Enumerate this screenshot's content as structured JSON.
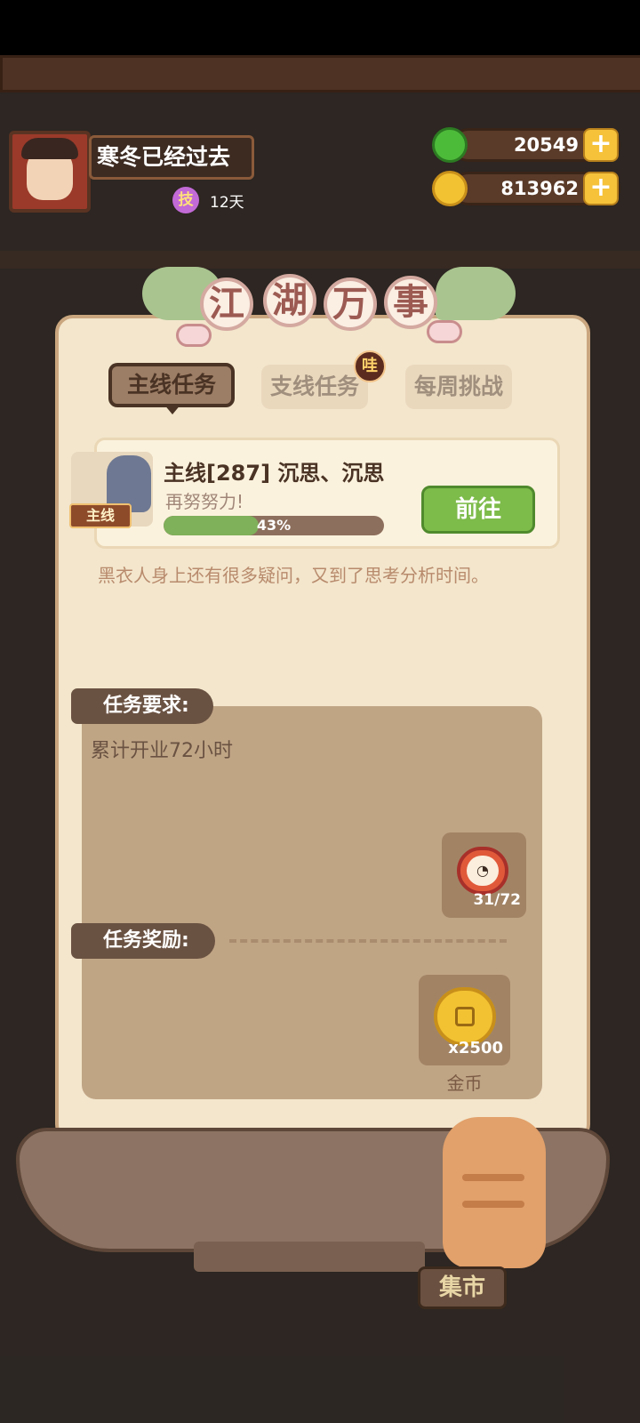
{
  "header": {
    "player_name": "寒冬已经过去",
    "skill_badge": "技",
    "days": "12天",
    "jade_amount": "20549",
    "coin_amount": "813962",
    "plus_label": "+"
  },
  "panel": {
    "title_chars": [
      "江",
      "湖",
      "万",
      "事"
    ],
    "tabs": {
      "main": "主线任务",
      "side": "支线任务",
      "side_badge": "哇",
      "weekly": "每周挑战"
    },
    "quest": {
      "tag": "主线",
      "title": "主线[287] 沉思、沉思",
      "subtitle": "再努努力!",
      "progress_label": "43%",
      "progress": 0.43,
      "go_button": "前往",
      "description": "黑衣人身上还有很多疑问，又到了思考分析时间。"
    },
    "requirement": {
      "label": "任务要求:",
      "text": "累计开业72小时",
      "timer": "31/72"
    },
    "reward": {
      "label": "任务奖励:",
      "quantity": "x2500",
      "name": "金币"
    }
  },
  "bottom": {
    "market_label": "集市"
  },
  "colors": {
    "panel_bg": "#f3e6cc",
    "progress_fill": "#7fb05a",
    "go_button": "#7dbb4a",
    "coin": "#f2c233"
  }
}
